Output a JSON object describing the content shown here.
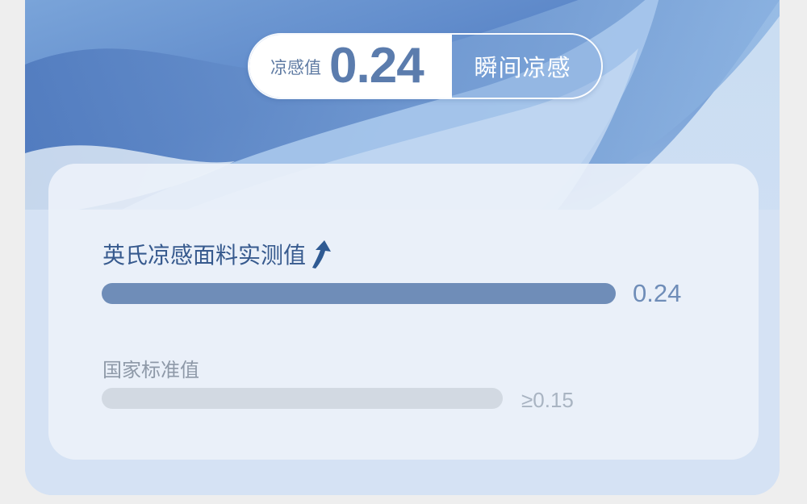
{
  "badge": {
    "label": "凉感值",
    "value": "0.24",
    "tag": "瞬间凉感"
  },
  "comparison": {
    "rows": [
      {
        "label": "英氏凉感面料实测值",
        "value_text": "0.24",
        "value": 0.24,
        "icon": "up-arrow-icon",
        "color": "#6f8db8"
      },
      {
        "label": "国家标准值",
        "value_text": "≥0.15",
        "value": 0.15,
        "color": "#d2d9e2"
      }
    ]
  },
  "colors": {
    "accent": "#5b7cad",
    "panel": "#ecf2fa",
    "card": "#d5e2f4"
  }
}
